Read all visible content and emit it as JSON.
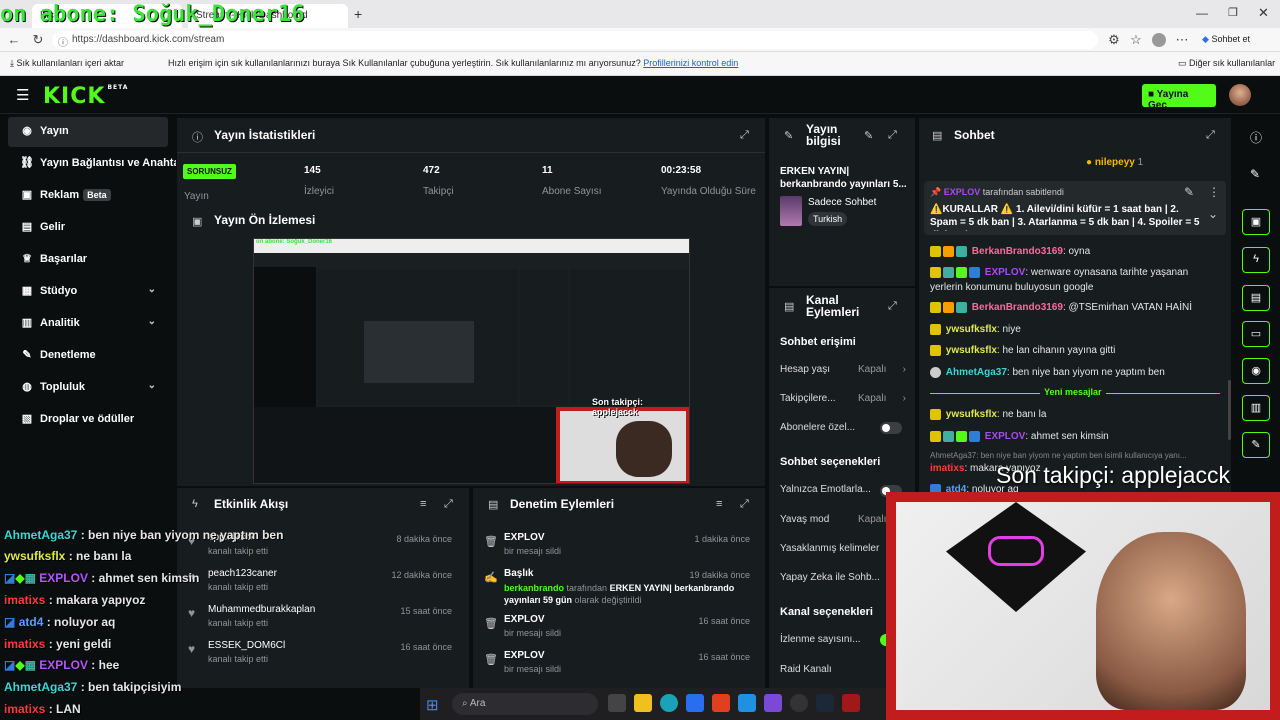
{
  "overlay": {
    "top_banner": "on abone: Soğuk_Doner16",
    "follower_banner": "Son takipçi: applejacck",
    "preview_banner": "Son takipçi: applejacck"
  },
  "browser": {
    "tab1_label": "Kick",
    "tab2_label": "Stream - Kick Dashboard",
    "url": "https://dashboard.kick.com/stream",
    "bookmark_import": "Sık kullanılanları içeri aktar",
    "bookmark_hint": "Hızlı erişim için sık kullanılanlarınızı buraya Sık Kullanılanlar çubuğuna yerleştirin. Sık kullanılanlarınız mı arıyorsunuz?",
    "bookmark_link": "Profillerinizi kontrol edin",
    "other_favorites": "Diğer sık kullanılanlar",
    "copilot": "Sohbet et"
  },
  "header": {
    "logo": "KICK",
    "logo_beta": "BETA",
    "go_live": "Yayına Geç"
  },
  "sidebar": {
    "items": [
      {
        "label": "Yayın"
      },
      {
        "label": "Yayın Bağlantısı ve Anahtar"
      },
      {
        "label": "Reklam",
        "badge": "Beta"
      },
      {
        "label": "Gelir"
      },
      {
        "label": "Başarılar"
      },
      {
        "label": "Stüdyo"
      },
      {
        "label": "Analitik"
      },
      {
        "label": "Denetleme"
      },
      {
        "label": "Topluluk"
      },
      {
        "label": "Droplar ve ödüller"
      }
    ]
  },
  "stats": {
    "title": "Yayın İstatistikleri",
    "status_badge": "SORUNSUZ",
    "status_label": "Yayın",
    "items": [
      {
        "value": "145",
        "label": "İzleyici"
      },
      {
        "value": "472",
        "label": "Takipçi"
      },
      {
        "value": "11",
        "label": "Abone Sayısı"
      },
      {
        "value": "00:23:58",
        "label": "Yayında Olduğu Süre"
      }
    ]
  },
  "preview": {
    "title": "Yayın Ön İzlemesi"
  },
  "stream_info": {
    "title_line1": "Yayın",
    "title_line2": "bilgisi",
    "stream_title": "ERKEN YAYIN| berkanbrando yayınları 5...",
    "category": "Sadece Sohbet",
    "language": "Turkish"
  },
  "channel_actions": {
    "title_line1": "Kanal",
    "title_line2": "Eylemleri",
    "chat_access": "Sohbet erişimi",
    "rows": [
      {
        "label": "Hesap yaşı",
        "value": "Kapalı"
      },
      {
        "label": "Takipçilere...",
        "value": "Kapalı"
      },
      {
        "label": "Abonelere özel..."
      }
    ],
    "chat_options": "Sohbet seçenekleri",
    "rows2": [
      {
        "label": "Yalnızca Emotlarla..."
      },
      {
        "label": "Yavaş mod",
        "value": "Kapalı"
      },
      {
        "label": "Yasaklanmış kelimeler"
      },
      {
        "label": "Yapay Zeka ile Sohb..."
      }
    ],
    "channel_options": "Kanal seçenekleri",
    "rows3": [
      {
        "label": "İzlenme sayısını..."
      },
      {
        "label": "Raid Kanalı"
      }
    ]
  },
  "activity": {
    "title": "Etkinlik Akışı",
    "items": [
      {
        "user": "applejacck",
        "action": "kanalı takip etti",
        "time": "8 dakika önce"
      },
      {
        "user": "peach123caner",
        "action": "kanalı takip etti",
        "time": "12 dakika önce"
      },
      {
        "user": "Muhammedburakkaplan",
        "action": "kanalı takip etti",
        "time": "15 saat önce"
      },
      {
        "user": "ESSEK_DOM6Cl",
        "action": "kanalı takip etti",
        "time": "16 saat önce"
      }
    ]
  },
  "moderation": {
    "title": "Denetim Eylemleri",
    "items": [
      {
        "title": "EXPLOV",
        "desc": "bir mesajı sildi",
        "time": "1 dakika önce"
      },
      {
        "title": "Başlık",
        "desc_user": "berkanbrando",
        "desc_mid": "tarafından",
        "desc_bold": "ERKEN YAYIN| berkanbrando yayınları 59 gün",
        "desc_end": "olarak değiştirildi",
        "time": "19 dakika önce"
      },
      {
        "title": "EXPLOV",
        "desc": "bir mesajı sildi",
        "time": "16 saat önce"
      },
      {
        "title": "EXPLOV",
        "desc": "bir mesajı sildi",
        "time": "16 saat önce"
      }
    ]
  },
  "chat": {
    "title": "Sohbet",
    "top_gifter": "nilepeyy",
    "top_gifter_count": "1",
    "pinned_by": "EXPLOV",
    "pinned_by_suffix": "tarafından sabitlendi",
    "pinned_text": "⚠️KURALLAR ⚠️ 1. Ailevi/dini küfür = 1 saat ban | 2. Spam = 5 dk ban | 3. Atarlanma = 5 dk ban | 4. Spoiler = 5 dk ban |...",
    "messages": [
      {
        "user": "BerkanBrando3169",
        "text": "oyna"
      },
      {
        "user": "EXPLOV",
        "text": "wenware oynasana tarihte yaşanan"
      },
      {
        "user": "",
        "text": "yerlerin konumunu buluyosun google"
      },
      {
        "user": "BerkanBrando3169",
        "text": "@TSEmirhan VATAN HAİNİ"
      },
      {
        "user": "ywsufksflx",
        "text": "niye"
      },
      {
        "user": "ywsufksflx",
        "text": "he lan cihanın yayına gitti"
      },
      {
        "user": "AhmetAga37",
        "text": "ben niye ban yiyom ne yaptım ben"
      },
      {
        "user": "ywsufksflx",
        "text": "ne banı la"
      },
      {
        "user": "EXPLOV",
        "text": "ahmet sen kimsin"
      },
      {
        "user": "atd4",
        "text": "noluyor aq"
      }
    ],
    "new_messages": "Yeni mesajlar",
    "reply_hint": "AhmetAga37: ben niye ban yiyom ne yaptım ben isimli kullanıcıya yanı...",
    "reply_user": "imatixs",
    "reply_text": "makara yapıyoz"
  },
  "overlay_chat": [
    {
      "user": "AhmetAga37",
      "text": "ben niye ban yiyom ne yaptım ben",
      "color": "#3fd6d6"
    },
    {
      "user": "ywsufksflx",
      "text": "ne banı la",
      "color": "#e0e84f"
    },
    {
      "user": "EXPLOV",
      "text": "ahmet sen kimsin",
      "color": "#b455ff"
    },
    {
      "user": "imatixs",
      "text": "makara yapıyoz",
      "color": "#ff3b3b"
    },
    {
      "user": "atd4",
      "text": "noluyor aq",
      "color": "#5aa0ff"
    },
    {
      "user": "imatixs",
      "text": "yeni geldi",
      "color": "#ff3b3b"
    },
    {
      "user": "EXPLOV",
      "text": "hee",
      "color": "#b455ff"
    },
    {
      "user": "AhmetAga37",
      "text": "ben takipçisiyim",
      "color": "#3fd6d6"
    },
    {
      "user": "imatixs",
      "text": "LAN",
      "color": "#ff3b3b"
    }
  ],
  "taskbar": {
    "search": "Ara"
  },
  "colors": {
    "accent": "#53fc18",
    "panel": "#171c1e",
    "background": "#0b0e0f"
  }
}
